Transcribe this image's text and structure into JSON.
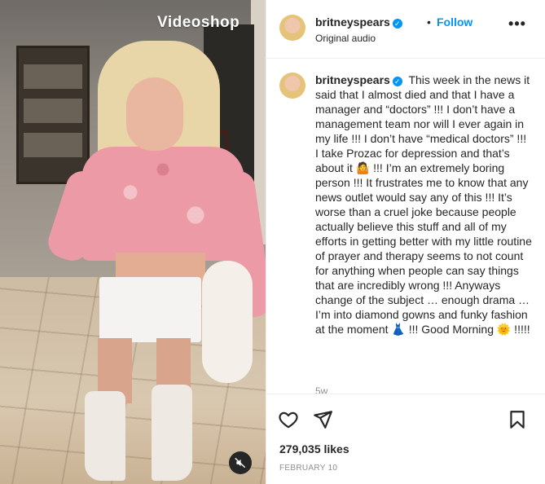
{
  "media": {
    "watermark": "Videoshop",
    "mute_icon": "speaker-muted-icon"
  },
  "header": {
    "username": "britneyspears",
    "verified_icon": "verified-badge-icon",
    "separator": "•",
    "follow_label": "Follow",
    "audio_label": "Original audio",
    "more_icon": "more-options-icon",
    "more_label": "•••"
  },
  "caption": {
    "username": "britneyspears",
    "text": "This week in the news it said that I almost died and that I have a manager and “doctors” !!! I don’t have a management team nor will I ever again in my life !!! I don’t have “medical doctors” !!! I take Prozac for depression and that’s about it 🤷 !!! I’m an extremely boring person !!! It frustrates me to know that any news outlet would say any of this !!! It’s worse than a cruel joke because people actually believe this stuff and all of my efforts in getting better with my little routine of prayer and therapy seems to not count for anything when people can say things that are incredibly wrong !!! Anyways change of the subject … enough drama … I’m into diamond gowns and funky fashion at the moment 👗 !!! Good Morning 🌞 !!!!!",
    "time_ago": "5w"
  },
  "actions": {
    "like_icon": "heart-icon",
    "share_icon": "paper-plane-icon",
    "save_icon": "bookmark-icon"
  },
  "likes": "279,035 likes",
  "date": "FEBRUARY 10",
  "colors": {
    "accent": "#0095f6",
    "text": "#262626",
    "muted": "#8e8e8e",
    "divider": "#efefef"
  }
}
